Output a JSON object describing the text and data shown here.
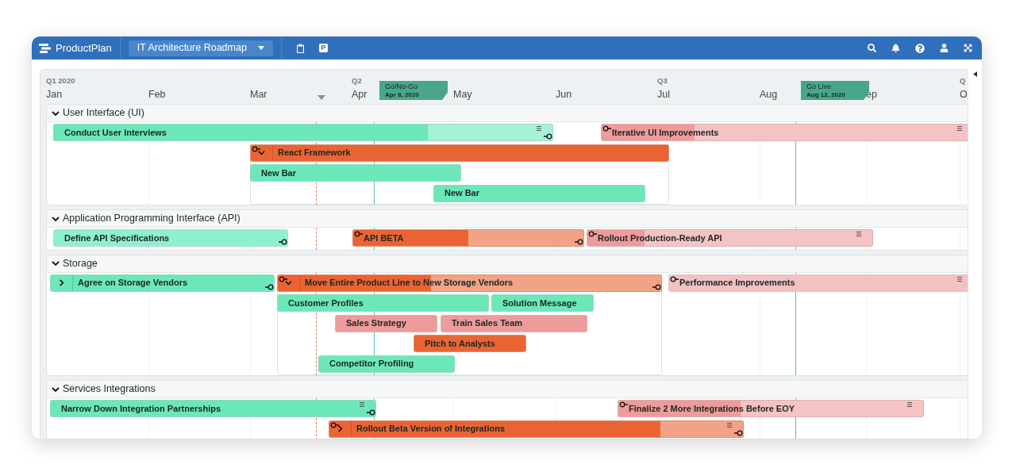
{
  "app_bar": {
    "product": "ProductPlan",
    "roadmap": "IT Architecture Roadmap",
    "badge_letter": "P"
  },
  "timeline": {
    "quarters": [
      "Q1 2020",
      "Q2",
      "Q3",
      "Q"
    ],
    "months": [
      "Jan",
      "Feb",
      "Mar",
      "Apr",
      "May",
      "Jun",
      "Jul",
      "Aug",
      "ep",
      "O"
    ]
  },
  "milestones": [
    {
      "title": "Go/No-Go",
      "date": "Apr 8, 2020"
    },
    {
      "title": "Go Live",
      "date": "Aug 12, 2020"
    }
  ],
  "lanes": [
    {
      "title": "User Interface (UI)",
      "expanded": true,
      "bars": [
        {
          "kind": "bar",
          "label": "Conduct User Interviews",
          "color": "#6ce8b8",
          "level": 0.75,
          "dep_in": false,
          "dep_out": true,
          "notes": true
        },
        {
          "kind": "bar",
          "label": "Iterative UI Improvements",
          "color": "#ee9b9b",
          "level": 0.25,
          "dep_in": true,
          "dep_out": false,
          "notes": true
        },
        {
          "kind": "container",
          "label": "React Framework",
          "color": "#ea6433",
          "level": 1,
          "dep_in": true,
          "dep_out": false,
          "notes": false,
          "expanded": true,
          "children": [
            {
              "kind": "bar",
              "label": "New Bar",
              "color": "#6ce8b8",
              "level": 1,
              "dep_in": false,
              "dep_out": false,
              "notes": false
            },
            {
              "kind": "bar",
              "label": "New Bar",
              "color": "#6ce8b8",
              "level": 1,
              "dep_in": false,
              "dep_out": false,
              "notes": false
            }
          ]
        }
      ]
    },
    {
      "title": "Application Programming Interface (API)",
      "expanded": true,
      "bars": [
        {
          "kind": "bar",
          "label": "Define API Specifications",
          "color": "#8ff0d0",
          "level": 1,
          "dep_in": false,
          "dep_out": true,
          "notes": false
        },
        {
          "kind": "bar",
          "label": "API BETA",
          "color": "#ea6433",
          "level": 0.5,
          "dep_in": true,
          "dep_out": true,
          "notes": false
        },
        {
          "kind": "bar",
          "label": "Rollout Production-Ready API",
          "color": "#ee9b9b",
          "level": 0.2,
          "dep_in": true,
          "dep_out": false,
          "notes": true
        }
      ]
    },
    {
      "title": "Storage",
      "expanded": true,
      "bars": [
        {
          "kind": "container",
          "label": "Agree on Storage Vendors",
          "color": "#6ce8b8",
          "level": 1,
          "dep_in": false,
          "dep_out": true,
          "notes": false,
          "expanded": false
        },
        {
          "kind": "container",
          "label": "Move Entire Product Line to New Storage Vendors",
          "color": "#ea6433",
          "level": 0.4,
          "dep_in": true,
          "dep_out": true,
          "notes": false,
          "expanded": true,
          "children": [
            {
              "kind": "bar",
              "label": "Customer Profiles",
              "color": "#6ce8b8",
              "level": 1,
              "dep_in": false,
              "dep_out": false,
              "notes": false
            },
            {
              "kind": "bar",
              "label": "Solution Message",
              "color": "#6ce8b8",
              "level": 1,
              "dep_in": false,
              "dep_out": false,
              "notes": false
            },
            {
              "kind": "bar",
              "label": "Sales Strategy",
              "color": "#ee9b9b",
              "level": 1,
              "dep_in": false,
              "dep_out": false,
              "notes": false
            },
            {
              "kind": "bar",
              "label": "Train Sales Team",
              "color": "#ee9b9b",
              "level": 1,
              "dep_in": false,
              "dep_out": false,
              "notes": false
            },
            {
              "kind": "bar",
              "label": "Pitch to Analysts",
              "color": "#ea6433",
              "level": 1,
              "dep_in": false,
              "dep_out": false,
              "notes": false
            },
            {
              "kind": "bar",
              "label": "Competitor Profiling",
              "color": "#6ce8b8",
              "level": 1,
              "dep_in": false,
              "dep_out": false,
              "notes": false
            }
          ]
        },
        {
          "kind": "bar",
          "label": "Performance Improvements",
          "color": "#f4c1c3",
          "level": 1,
          "dep_in": true,
          "dep_out": false,
          "notes": true
        }
      ]
    },
    {
      "title": "Services Integrations",
      "expanded": true,
      "bars": [
        {
          "kind": "bar",
          "label": "Narrow Down Integration Partnerships",
          "color": "#6ce8b8",
          "level": 1,
          "dep_in": false,
          "dep_out": true,
          "notes": true
        },
        {
          "kind": "bar",
          "label": "Finalize 2 More Integrations Before EOY",
          "color": "#ee9b9b",
          "level": 0.4,
          "dep_in": true,
          "dep_out": false,
          "notes": true
        },
        {
          "kind": "container",
          "label": "Rollout Beta Version of Integrations",
          "color": "#ea6433",
          "level": 0.8,
          "dep_in": true,
          "dep_out": true,
          "notes": true,
          "expanded": false
        }
      ]
    }
  ]
}
